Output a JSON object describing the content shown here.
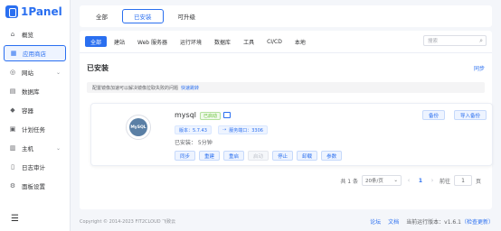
{
  "brand": {
    "name": "1Panel",
    "color": "#2a6ff0"
  },
  "sidebar": {
    "items": [
      {
        "label": "概览",
        "icon": "home-icon",
        "active": false,
        "chevron": false
      },
      {
        "label": "应用商店",
        "icon": "grid-icon",
        "active": true,
        "chevron": false
      },
      {
        "label": "网站",
        "icon": "globe-icon",
        "active": false,
        "chevron": true
      },
      {
        "label": "数据库",
        "icon": "database-icon",
        "active": false,
        "chevron": false
      },
      {
        "label": "容器",
        "icon": "docker-icon",
        "active": false,
        "chevron": false
      },
      {
        "label": "计划任务",
        "icon": "calendar-icon",
        "active": false,
        "chevron": false
      },
      {
        "label": "主机",
        "icon": "server-icon",
        "active": false,
        "chevron": true
      },
      {
        "label": "日志审计",
        "icon": "log-icon",
        "active": false,
        "chevron": false
      },
      {
        "label": "面板设置",
        "icon": "settings-icon",
        "active": false,
        "chevron": false
      }
    ]
  },
  "top_tabs": [
    {
      "label": "全部",
      "active": false
    },
    {
      "label": "已安装",
      "active": true
    },
    {
      "label": "可升级",
      "active": false
    }
  ],
  "filter_tabs": [
    {
      "label": "全部",
      "active": true
    },
    {
      "label": "建站",
      "active": false
    },
    {
      "label": "Web 服务器",
      "active": false
    },
    {
      "label": "运行环境",
      "active": false
    },
    {
      "label": "数据库",
      "active": false
    },
    {
      "label": "工具",
      "active": false
    },
    {
      "label": "CI/CD",
      "active": false
    },
    {
      "label": "本地",
      "active": false
    }
  ],
  "search": {
    "placeholder": "搜索"
  },
  "section": {
    "title": "已安装",
    "sync_label": "同步",
    "notice": "配置镜像加速可以解决镜像拉取失败的问题",
    "notice_link": "快速跳转"
  },
  "app": {
    "name": "mysql",
    "status": "已启动",
    "logo_text": "MySQL",
    "version_label": "版本：5.7.43",
    "port_label": "服务端口：3306",
    "uptime": "已安装： 5分钟",
    "actions": [
      {
        "label": "同步",
        "disabled": false
      },
      {
        "label": "重建",
        "disabled": false
      },
      {
        "label": "重启",
        "disabled": false
      },
      {
        "label": "启动",
        "disabled": true
      },
      {
        "label": "停止",
        "disabled": false
      },
      {
        "label": "卸载",
        "disabled": false
      },
      {
        "label": "参数",
        "disabled": false
      }
    ],
    "backup_label": "备份",
    "import_backup_label": "导入备份"
  },
  "pagination": {
    "total": "共 1 条",
    "page_size": "20条/页",
    "current_page": "1",
    "goto_label": "前往",
    "goto_value": "1",
    "page_suffix": "页"
  },
  "footer": {
    "copyright": "Copyright © 2014-2023 FIT2CLOUD 飞致云",
    "forum": "论坛",
    "docs": "文档",
    "version_prefix": "当前运行版本：v1.6.1",
    "version_check": "（检查更新）"
  }
}
